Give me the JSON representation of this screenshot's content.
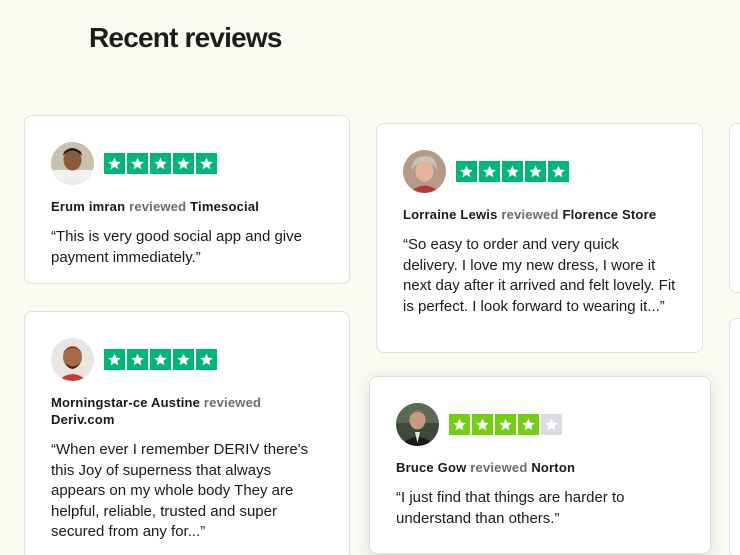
{
  "page": {
    "heading": "Recent reviews"
  },
  "reviews": [
    {
      "reviewer": "Erum imran",
      "reviewed_word": "reviewed",
      "company": "Timesocial",
      "rating": 5,
      "text": "“This is very good social app and give payment immediately.”",
      "avatar": "photo-young-man-icon"
    },
    {
      "reviewer": "Lorraine Lewis",
      "reviewed_word": "reviewed",
      "company": "Florence Store",
      "rating": 5,
      "text": "“So easy to order and very quick delivery. I love my new dress, I wore it next day after it arrived and felt lovely. Fit is perfect. I look forward to wearing it...”",
      "avatar": "photo-older-woman-icon"
    },
    {
      "reviewer": "Morningstar-ce Austine",
      "reviewed_word": "reviewed",
      "company": "Deriv.com",
      "rating": 5,
      "text": "“When ever I remember DERIV there's this Joy of superness that always appears on my whole body They are helpful, reliable, trusted and super secured from any for...”",
      "avatar": "photo-man-icon"
    },
    {
      "reviewer": "Bruce Gow",
      "reviewed_word": "reviewed",
      "company": "Norton",
      "rating": 4,
      "text": "“I just find that things are harder to understand than others.”",
      "avatar": "photo-man-suit-icon"
    }
  ],
  "colors": {
    "background": "#fbfaf3",
    "star_5": "#00b67a",
    "star_4": "#73cf11",
    "star_empty": "#dcdce6"
  }
}
